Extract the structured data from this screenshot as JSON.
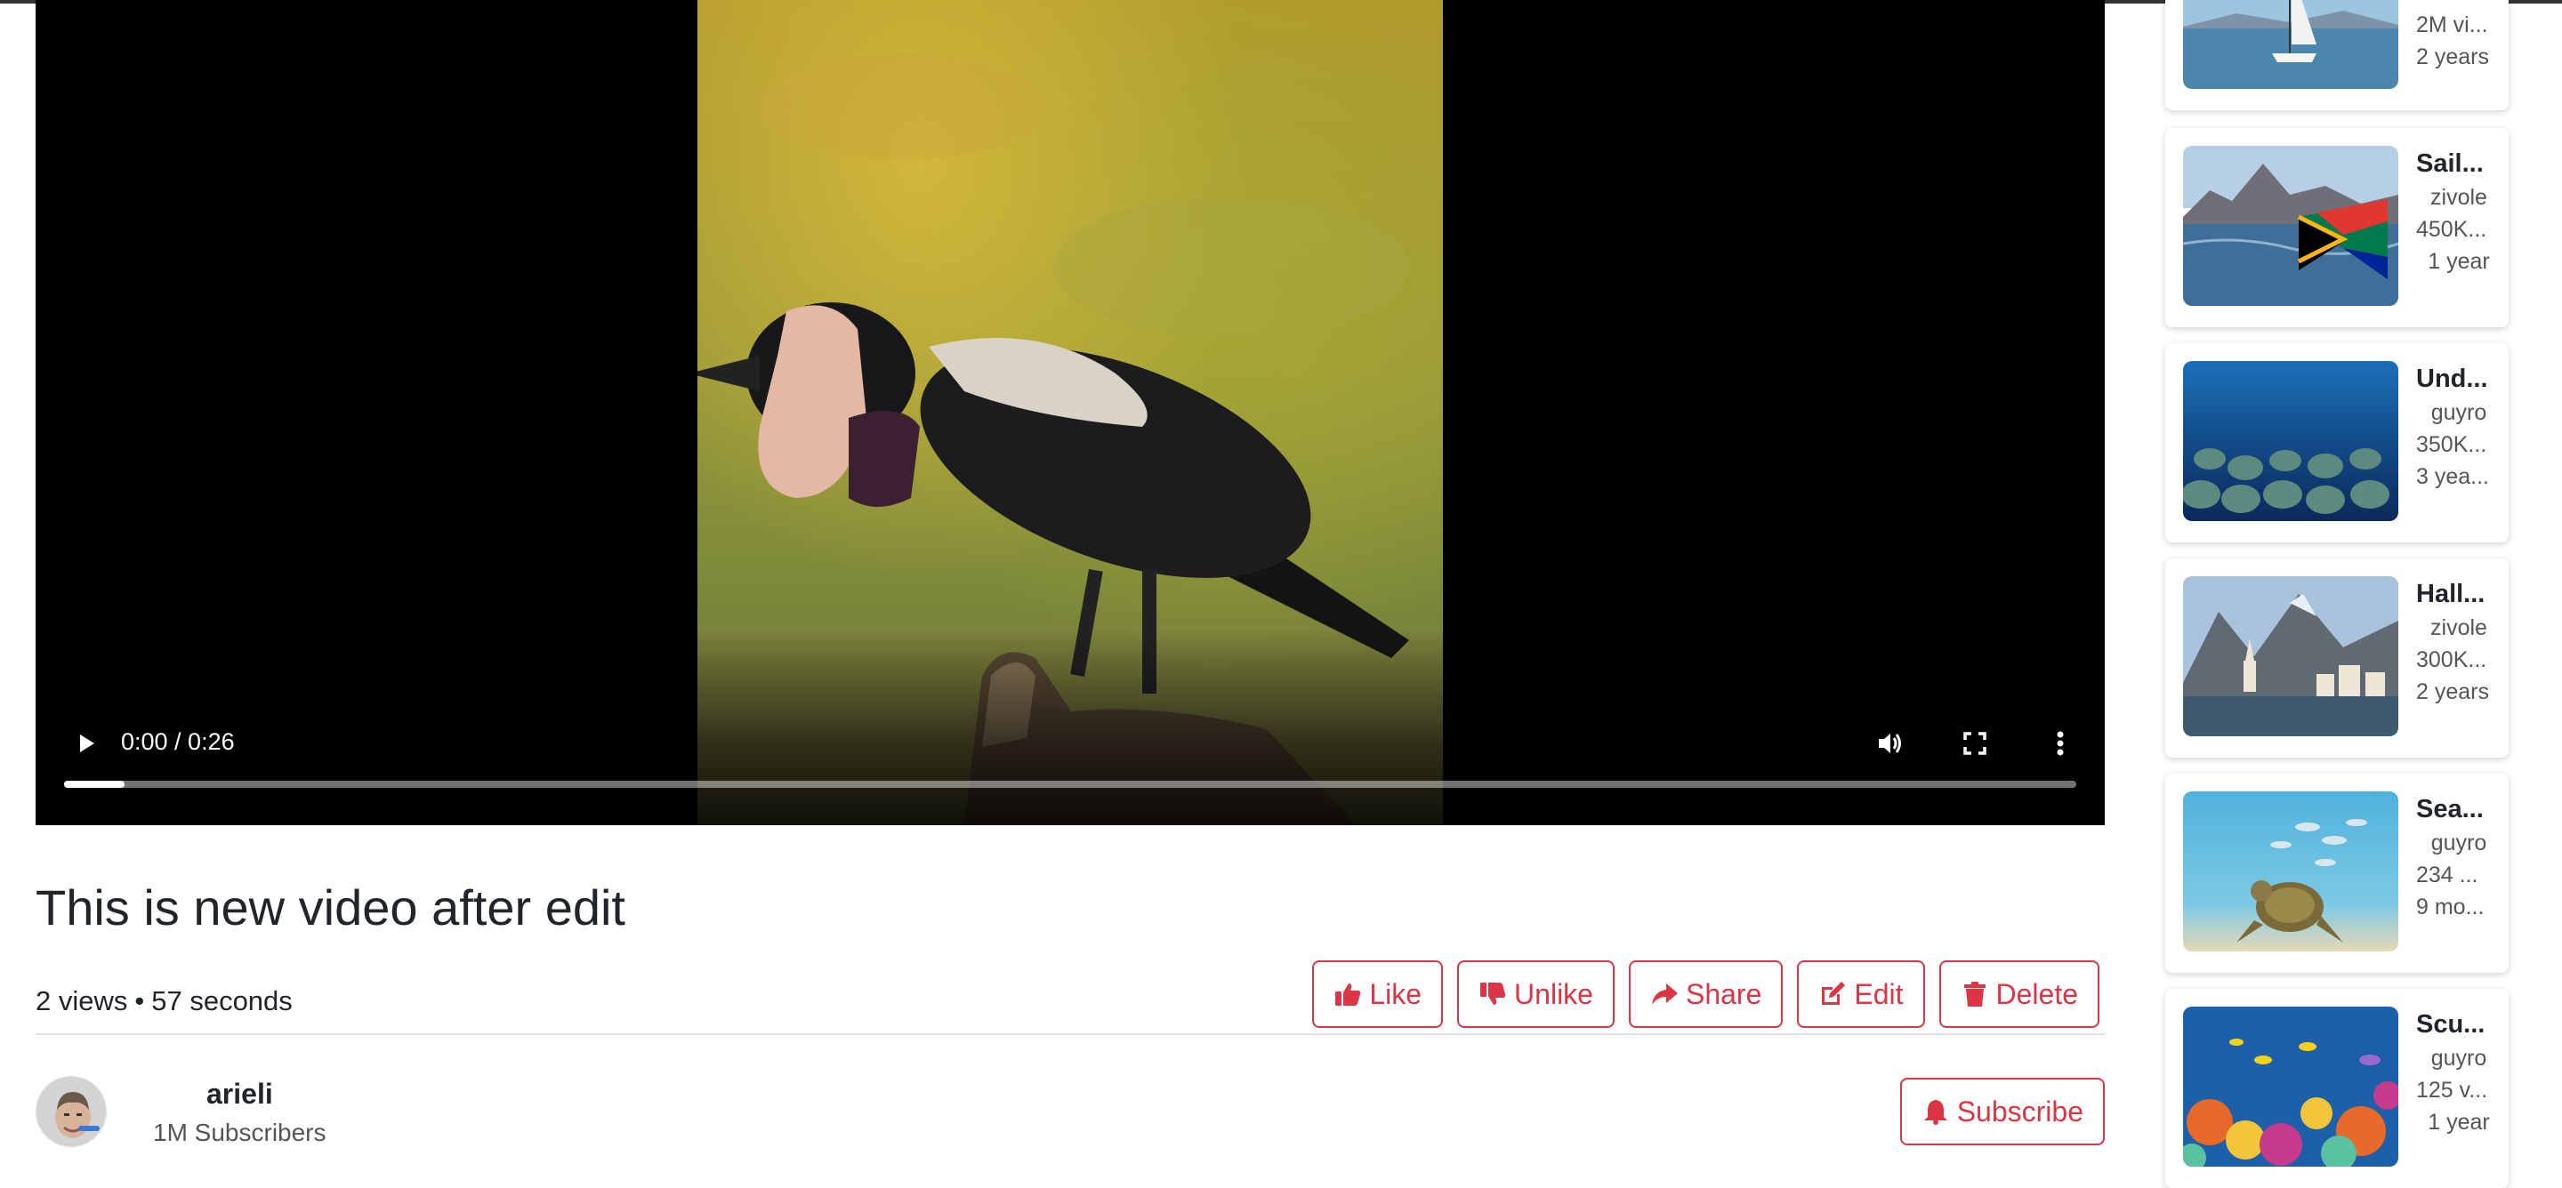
{
  "player": {
    "time": "0:00 / 0:26",
    "progress_fraction": 0.03
  },
  "video": {
    "title": "This is new video after edit",
    "views": "2 views",
    "duration": "57 seconds"
  },
  "actions": {
    "like": "Like",
    "unlike": "Unlike",
    "share": "Share",
    "edit": "Edit",
    "delete": "Delete"
  },
  "channel": {
    "name": "arieli",
    "subscribers": "1M Subscribers",
    "subscribe_label": "Subscribe"
  },
  "icons": {
    "play": "play-icon",
    "volume": "volume-icon",
    "fullscreen": "fullscreen-icon",
    "more": "more-vertical-icon",
    "like": "thumbs-up-icon",
    "unlike": "thumbs-down-icon",
    "share": "share-arrow-icon",
    "edit": "edit-icon",
    "delete": "trash-icon",
    "subscribe": "bell-icon"
  },
  "colors": {
    "accent": "#dc3545",
    "player_bg": "#000000"
  },
  "sidebar": {
    "items": [
      {
        "title": "",
        "channel": "",
        "views": "2M vi...",
        "age": "2 years"
      },
      {
        "title": "Sail...",
        "channel": "zivole",
        "views": "450K...",
        "age": "1 year"
      },
      {
        "title": "Und...",
        "channel": "guyro",
        "views": "350K...",
        "age": "3 yea..."
      },
      {
        "title": "Hall...",
        "channel": "zivole",
        "views": "300K...",
        "age": "2 years"
      },
      {
        "title": "Sea...",
        "channel": "guyro",
        "views": "234 ...",
        "age": "9 mo..."
      },
      {
        "title": "Scu...",
        "channel": "guyro",
        "views": "125 v...",
        "age": "1 year"
      }
    ]
  }
}
